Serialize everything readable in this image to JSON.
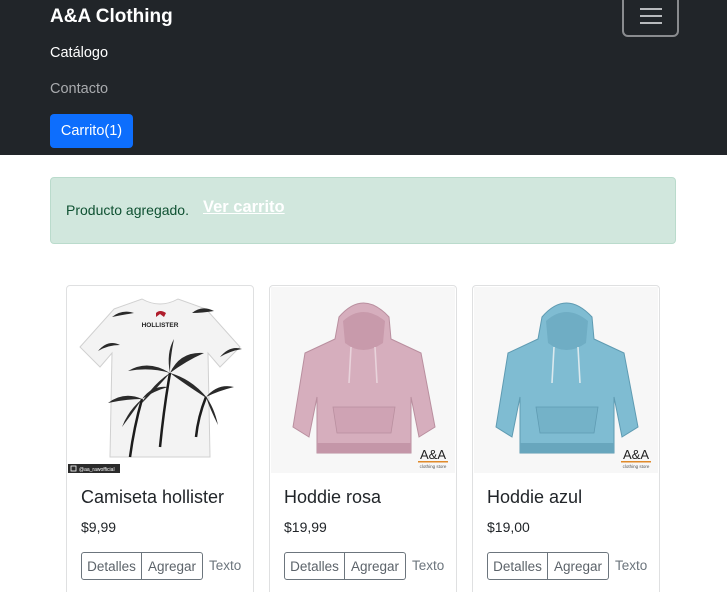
{
  "navbar": {
    "brand": "A&A Clothing",
    "links": [
      "Catálogo",
      "Contacto"
    ],
    "cart_button": "Carrito(1)"
  },
  "alert": {
    "message": "Producto agregado.",
    "link": "Ver carrito"
  },
  "products": [
    {
      "name": "Camiseta hollister",
      "price": "$9,99",
      "details_label": "Detalles",
      "add_label": "Agregar",
      "text_label": "Texto",
      "image": "white palm tree t-shirt",
      "image_brand_text": "HOLLISTER",
      "watermark": "@aa_rawofficial"
    },
    {
      "name": "Hoddie rosa",
      "price": "$19,99",
      "details_label": "Detalles",
      "add_label": "Agregar",
      "text_label": "Texto",
      "image": "pink hoodie",
      "image_color": "#d6aebd",
      "logo": "A&A",
      "logo_sub": "clothing store"
    },
    {
      "name": "Hoddie azul",
      "price": "$19,00",
      "details_label": "Detalles",
      "add_label": "Agregar",
      "text_label": "Texto",
      "image": "blue hoodie",
      "image_color": "#7fbcd2",
      "logo": "A&A",
      "logo_sub": "clothing store"
    }
  ],
  "colors": {
    "navbar_bg": "#212529",
    "primary": "#0d6efd",
    "alert_bg": "#d1e7dd",
    "alert_text": "#0f5132"
  }
}
